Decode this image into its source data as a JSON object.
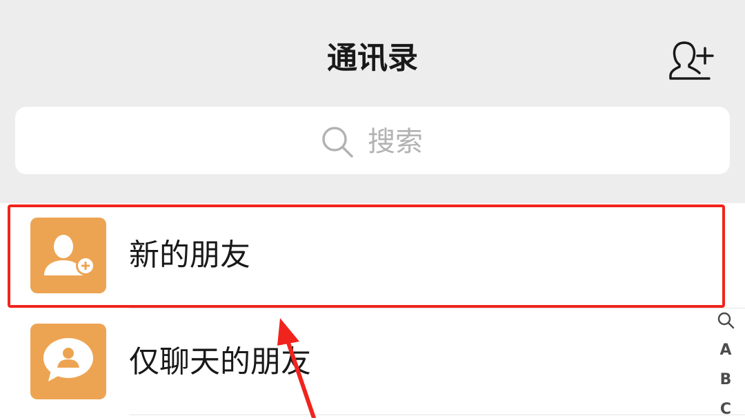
{
  "header": {
    "title": "通讯录",
    "add_contact_icon": "person-add-icon"
  },
  "search": {
    "placeholder": "搜索",
    "icon": "search-icon"
  },
  "list": {
    "items": [
      {
        "label": "新的朋友",
        "icon": "new-friend-icon",
        "highlighted": true
      },
      {
        "label": "仅聊天的朋友",
        "icon": "chat-only-friend-icon"
      }
    ]
  },
  "index_bar": {
    "search_icon": "search-icon",
    "letters": [
      "A",
      "B",
      "C"
    ]
  },
  "annotation": {
    "highlight_color": "#f0241c",
    "arrow": "red-arrow-pointing-up"
  },
  "colors": {
    "header_bg": "#ededed",
    "icon_orange": "#eda452",
    "placeholder_gray": "#b2b2b2"
  }
}
